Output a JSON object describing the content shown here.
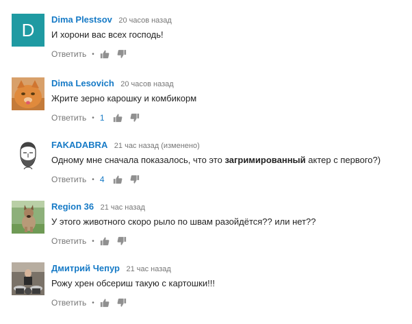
{
  "reply_label": "Ответить",
  "bullet": "•",
  "comments": [
    {
      "author": "Dima Plestsov",
      "time": "20 часов назад",
      "text": "И хорони вас всех господь!",
      "likes": "",
      "avatar": {
        "type": "letter",
        "letter": "D",
        "color": "#1f9aa2"
      }
    },
    {
      "author": "Dima Lesovich",
      "time": "20 часов назад",
      "text": "Жрите зерно карошку и комбикорм",
      "likes": "1",
      "avatar": {
        "type": "photo",
        "icon": "cat-avatar-icon"
      }
    },
    {
      "author": "FAKADABRA",
      "time": "21 час назад (изменено)",
      "text_before": "Одному мне сначала показалось, что это ",
      "text_bold": "загримированный",
      "text_after": " актер с первого?)",
      "likes": "4",
      "avatar": {
        "type": "photo",
        "icon": "bearded-man-avatar-icon"
      }
    },
    {
      "author": "Region 36",
      "time": "21 час назад",
      "text": "У этого животного скоро рыло по швам разойдётся?? или нет??",
      "likes": "",
      "avatar": {
        "type": "photo",
        "icon": "dog-avatar-icon"
      }
    },
    {
      "author": "Дмитрий Чепур",
      "time": "21 час назад",
      "text": "Рожу хрен обсериш такую с картошки!!!",
      "likes": "",
      "avatar": {
        "type": "photo",
        "icon": "drummer-avatar-icon"
      }
    }
  ]
}
